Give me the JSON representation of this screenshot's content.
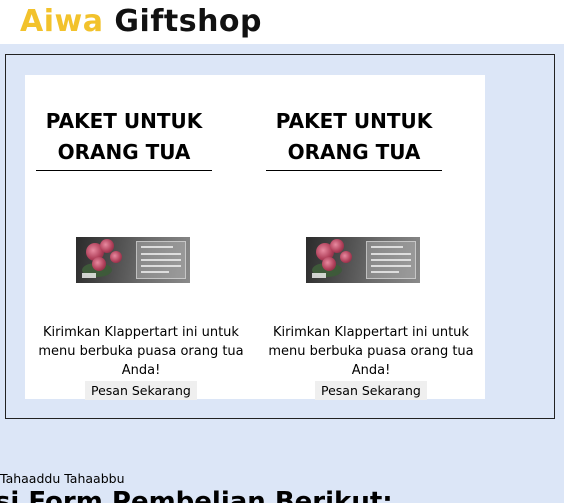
{
  "header": {
    "brand_part1": "Aiwa",
    "brand_part2": "Giftshop",
    "brand_color_accent": "#f2c22c",
    "brand_color_main": "#111111"
  },
  "products": [
    {
      "title": "PAKET UNTUK ORANG TUA",
      "image": "product-thumbnail-roses",
      "description": "Kirimkan Klappertart ini untuk menu berbuka puasa orang tua Anda!",
      "button_label": "Pesan Sekarang"
    },
    {
      "title": "PAKET UNTUK ORANG TUA",
      "image": "product-thumbnail-roses",
      "description": "Kirimkan Klappertart ini untuk menu berbuka puasa orang tua Anda!",
      "button_label": "Pesan Sekarang"
    }
  ],
  "footer_text": {
    "small": "Tahaaddu Tahaabbu",
    "heading_partial": "isi Form Pembelian Berikut:"
  },
  "colors": {
    "page_background": "#dce6f7",
    "card_background": "#ffffff",
    "button_background": "#efefef"
  }
}
